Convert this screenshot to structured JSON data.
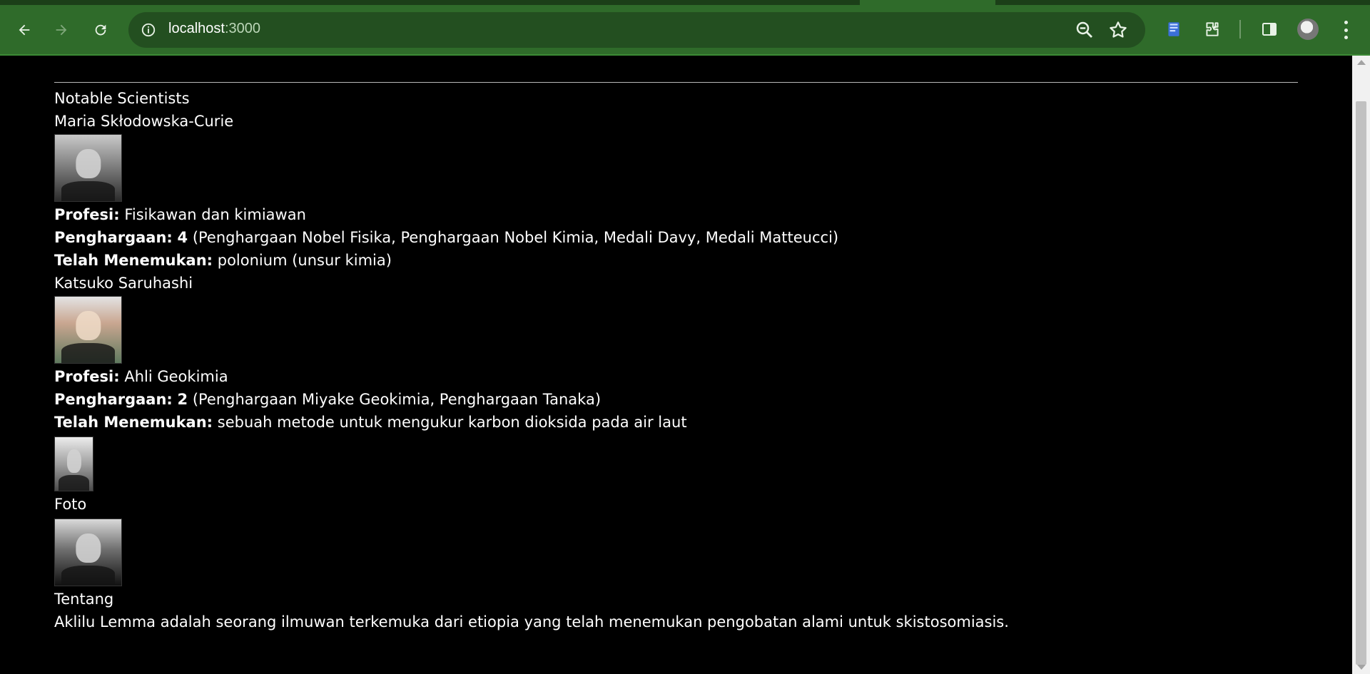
{
  "browser": {
    "url_host": "localhost",
    "url_port": ":3000",
    "back_icon": "arrow-left-icon",
    "forward_icon": "arrow-right-icon",
    "reload_icon": "reload-icon",
    "site_info_icon": "info-icon",
    "zoom_icon": "zoom-icon",
    "bookmark_icon": "star-icon",
    "extension1_icon": "book-icon",
    "extensions_icon": "puzzle-icon",
    "sidepanel_icon": "side-panel-icon",
    "menu_icon": "kebab-menu-icon"
  },
  "page": {
    "section_title": "Notable Scientists",
    "labels": {
      "profession": "Profesi:",
      "awards": "Penghargaan:",
      "discovered": "Telah Menemukan:"
    },
    "scientists": [
      {
        "name": "Maria Skłodowska-Curie",
        "profession": "Fisikawan dan kimiawan",
        "awards_count": "4",
        "awards_list": "(Penghargaan Nobel Fisika, Penghargaan Nobel Kimia, Medali Davy, Medali Matteucci)",
        "discovered": "polonium (unsur kimia)"
      },
      {
        "name": "Katsuko Saruhashi",
        "profession": "Ahli Geokimia",
        "awards_count": "2",
        "awards_list": "(Penghargaan Miyake Geokimia, Penghargaan Tanaka)",
        "discovered": "sebuah metode untuk mengukur karbon dioksida pada air laut"
      }
    ],
    "photo_heading": "Foto",
    "about_heading": "Tentang",
    "about_text": "Aklilu Lemma adalah seorang ilmuwan terkemuka dari etiopia yang telah menemukan pengobatan alami untuk skistosomiasis."
  },
  "colors": {
    "chrome": "#2f6b2a",
    "omnibox": "#234f20",
    "page_bg": "#000000",
    "text": "#ffffff"
  }
}
